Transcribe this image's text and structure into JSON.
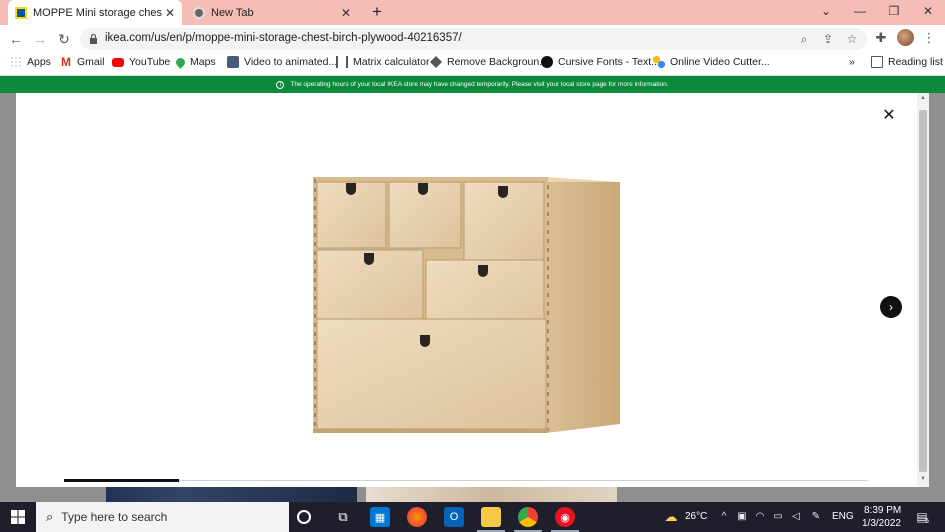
{
  "browser": {
    "tabs": [
      {
        "title": "MOPPE Mini storage chest, birch",
        "active": true
      },
      {
        "title": "New Tab",
        "active": false
      }
    ],
    "url": "ikea.com/us/en/p/moppe-mini-storage-chest-birch-plywood-40216357/",
    "bookmarks": [
      {
        "label": "Apps",
        "icon": "apps-grid-icon"
      },
      {
        "label": "Gmail",
        "icon": "gmail-icon"
      },
      {
        "label": "YouTube",
        "icon": "youtube-icon"
      },
      {
        "label": "Maps",
        "icon": "maps-icon"
      },
      {
        "label": "Video to animated...",
        "icon": "video-icon"
      },
      {
        "label": "Matrix calculator",
        "icon": "matrix-icon"
      },
      {
        "label": "Remove Backgroun...",
        "icon": "remove-bg-icon"
      },
      {
        "label": "Cursive Fonts - Text...",
        "icon": "cursive-icon"
      },
      {
        "label": "Online Video Cutter...",
        "icon": "video-cutter-icon"
      }
    ],
    "more_bookmarks": "»",
    "reading_list": "Reading list"
  },
  "page": {
    "banner_text": "The operating hours of your local IKEA store may have changed temporarily. Please visit your local store page for more information.",
    "gallery_progress": 0.143
  },
  "taskbar": {
    "search_placeholder": "Type here to search",
    "weather": "26°C",
    "language": "ENG",
    "time": "8:39 PM",
    "date": "1/3/2022",
    "notification_count": "5"
  },
  "colors": {
    "tab_strip": "#f6bdb6",
    "banner": "#0a8a3a",
    "taskbar": "#1f1f2b"
  }
}
